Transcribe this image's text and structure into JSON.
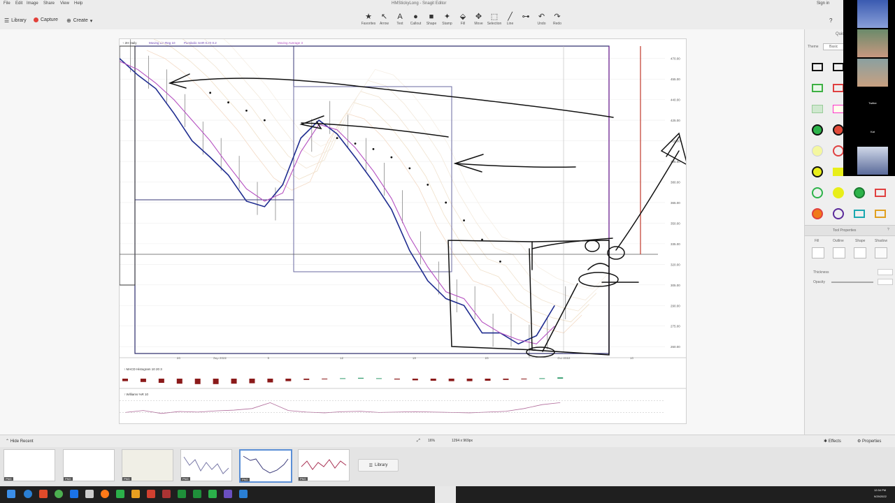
{
  "window": {
    "title": "HMStickyLong - Snagit Editor",
    "menus": [
      "File",
      "Edit",
      "Image",
      "Share",
      "View",
      "Help"
    ],
    "sign_in": "Sign in"
  },
  "toolbar": {
    "library": "Library",
    "capture": "Capture",
    "create": "Create",
    "tools": [
      {
        "label": "Favorites",
        "icon": "★"
      },
      {
        "label": "Arrow",
        "icon": "↖"
      },
      {
        "label": "Text",
        "icon": "A"
      },
      {
        "label": "Callout",
        "icon": "●"
      },
      {
        "label": "Shape",
        "icon": "■"
      },
      {
        "label": "Stamp",
        "icon": "✦"
      },
      {
        "label": "Fill",
        "icon": "⬙"
      },
      {
        "label": "Move",
        "icon": "✥"
      },
      {
        "label": "Selection",
        "icon": "⬚"
      },
      {
        "label": "Line",
        "icon": "╱"
      },
      {
        "label": "",
        "icon": "⊶"
      },
      {
        "label": "Undo",
        "icon": "↶"
      },
      {
        "label": "Redo",
        "icon": "↷"
      }
    ]
  },
  "chart_header": {
    "symbol": "↑ 2H Daily",
    "study1": "Moving Lin Reg 10",
    "study2": "Parabolic SAR 0.02 0.2",
    "study3": "Moving Average 3"
  },
  "chart_data": {
    "type": "line",
    "title": "",
    "ylim": [
      255,
      478
    ],
    "price_ticks": [
      {
        "y": 470,
        "label": "470.00"
      },
      {
        "y": 455,
        "label": "455.00"
      },
      {
        "y": 440,
        "label": "440.00"
      },
      {
        "y": 425,
        "label": "425.00"
      },
      {
        "y": 410,
        "label": "410.00"
      },
      {
        "y": 395,
        "label": "395.00"
      },
      {
        "y": 380,
        "label": "380.00"
      },
      {
        "y": 365,
        "label": "365.00"
      },
      {
        "y": 350,
        "label": "350.00"
      },
      {
        "y": 335,
        "label": "335.00"
      },
      {
        "y": 320,
        "label": "320.00"
      },
      {
        "y": 305,
        "label": "305.00"
      },
      {
        "y": 290,
        "label": "290.00"
      },
      {
        "y": 275,
        "label": "275.00"
      },
      {
        "y": 260,
        "label": "260.00"
      }
    ],
    "date_ticks": [
      {
        "x": 2,
        "label": "26"
      },
      {
        "x": 4,
        "label": "Sep 2022"
      },
      {
        "x": 7,
        "label": "9"
      },
      {
        "x": 11,
        "label": "12"
      },
      {
        "x": 15,
        "label": "19"
      },
      {
        "x": 19,
        "label": "26"
      },
      {
        "x": 23,
        "label": "Oct 2022"
      },
      {
        "x": 27,
        "label": "10"
      }
    ],
    "series": [
      {
        "color": "#1f2c8f",
        "x": [
          0,
          1,
          2,
          3,
          4,
          5,
          6,
          7,
          8,
          9,
          10,
          11,
          12,
          13,
          14,
          15,
          16,
          17,
          18,
          19,
          20,
          21,
          22,
          23,
          24
        ],
        "values": [
          470,
          458,
          448,
          430,
          410,
          398,
          385,
          366,
          362,
          378,
          412,
          425,
          415,
          398,
          380,
          360,
          330,
          308,
          295,
          290,
          270,
          270,
          262,
          268,
          290
        ]
      },
      {
        "color": "#b44fc0",
        "x": [
          0,
          1,
          2,
          3,
          4,
          5,
          6,
          7,
          8,
          9,
          10,
          11,
          12,
          13,
          14,
          15,
          16,
          17,
          18,
          19,
          20,
          21,
          22,
          23,
          24
        ],
        "values": [
          468,
          462,
          452,
          440,
          425,
          410,
          392,
          375,
          366,
          372,
          402,
          422,
          418,
          405,
          388,
          368,
          340,
          318,
          300,
          295,
          278,
          270,
          265,
          262,
          275
        ]
      }
    ],
    "sar_dots": [
      {
        "x": 5,
        "y": 445
      },
      {
        "x": 6,
        "y": 438
      },
      {
        "x": 7,
        "y": 432
      },
      {
        "x": 8,
        "y": 425
      },
      {
        "x": 12,
        "y": 412
      },
      {
        "x": 13,
        "y": 408
      },
      {
        "x": 14,
        "y": 404
      },
      {
        "x": 15,
        "y": 398
      },
      {
        "x": 16,
        "y": 390
      },
      {
        "x": 17,
        "y": 378
      },
      {
        "x": 18,
        "y": 365
      },
      {
        "x": 19,
        "y": 352
      },
      {
        "x": 20,
        "y": 338
      },
      {
        "x": 21,
        "y": 322
      }
    ],
    "indicator1_label": "↑ MACD Histogram 10 20 3",
    "indicator1_values": [
      -0.6,
      -0.8,
      -1.0,
      -1.2,
      -1.3,
      -1.3,
      -1.2,
      -1.1,
      -0.9,
      -0.6,
      -0.3,
      -0.1,
      0.1,
      0.2,
      0.1,
      -0.2,
      -0.4,
      -0.5,
      -0.6,
      -0.6,
      -0.5,
      -0.3,
      -0.1,
      0.1,
      0.3
    ],
    "indicator2_label": "↑ Williams %R 10",
    "indicator2_values": [
      -80,
      -70,
      -85,
      -75,
      -78,
      -72,
      -68,
      -60,
      -30,
      -70,
      -78,
      -82,
      -76,
      -74,
      -80,
      -78,
      -76,
      -78,
      -80,
      -82,
      -78,
      -74,
      -60,
      -40,
      -30
    ]
  },
  "right_panel": {
    "title": "Quick Styles",
    "tabs": [
      "Theme",
      "Basic"
    ],
    "shape_properties": "Tool Properties",
    "prop_labels": [
      "Fill",
      "Outline",
      "Shape",
      "Shadow"
    ],
    "thickness": "Thickness",
    "opacity": "Opacity"
  },
  "status": {
    "left": "Hide Recent",
    "zoom": "16%",
    "size": "1294 x 969px",
    "effects": "Effects",
    "properties": "Properties"
  },
  "thumbnails": {
    "tags": [
      "PNG",
      "PNG",
      "PNG",
      "PNG",
      "PNG",
      "PNG"
    ],
    "library_button": "Library"
  },
  "webcams": {
    "names": [
      "",
      "",
      "",
      "Twitter",
      "Kat",
      ""
    ]
  },
  "clock": {
    "time": "12:34 PM",
    "date": "9/29/2022"
  }
}
